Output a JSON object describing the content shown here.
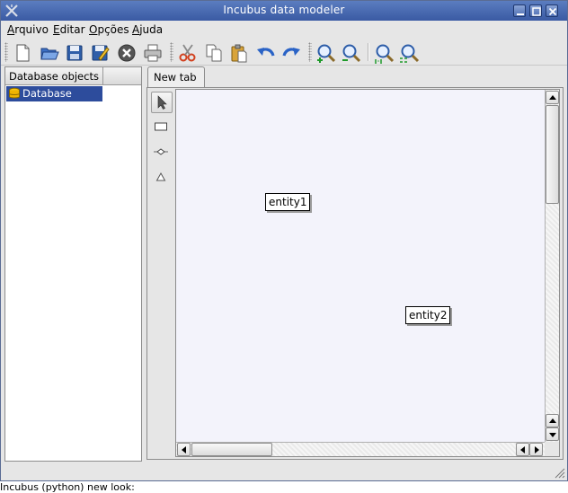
{
  "window": {
    "title": "Incubus data modeler"
  },
  "menu": {
    "items": [
      {
        "mnemonic": "A",
        "rest": "rquivo"
      },
      {
        "mnemonic": "E",
        "rest": "ditar"
      },
      {
        "mnemonic": "O",
        "rest": "pções"
      },
      {
        "mnemonic": "A",
        "rest": "juda"
      }
    ]
  },
  "toolbar": {
    "icons": [
      "new-document-icon",
      "open-folder-icon",
      "save-icon",
      "save-as-icon",
      "stop-icon",
      "print-icon",
      "cut-icon",
      "copy-icon",
      "paste-icon",
      "undo-icon",
      "redo-icon",
      "zoom-in-icon",
      "zoom-out-icon",
      "zoom-1-1-icon",
      "zoom-fit-icon"
    ]
  },
  "tree": {
    "header": "Database objects",
    "items": [
      {
        "label": "Database",
        "icon": "database-icon",
        "selected": true
      }
    ]
  },
  "tabs": [
    {
      "label": "New tab",
      "active": true
    }
  ],
  "palette": {
    "tools": [
      "pointer-icon",
      "entity-rect-icon",
      "relationship-icon",
      "inheritance-icon"
    ]
  },
  "canvas": {
    "entities": [
      {
        "label": "entity1"
      },
      {
        "label": "entity2"
      }
    ]
  },
  "caption": "Incubus (python) new look:",
  "colors": {
    "titlebar": "#3a5aa3",
    "selection": "#2d4c9c",
    "canvas": "#f3f3fb"
  }
}
